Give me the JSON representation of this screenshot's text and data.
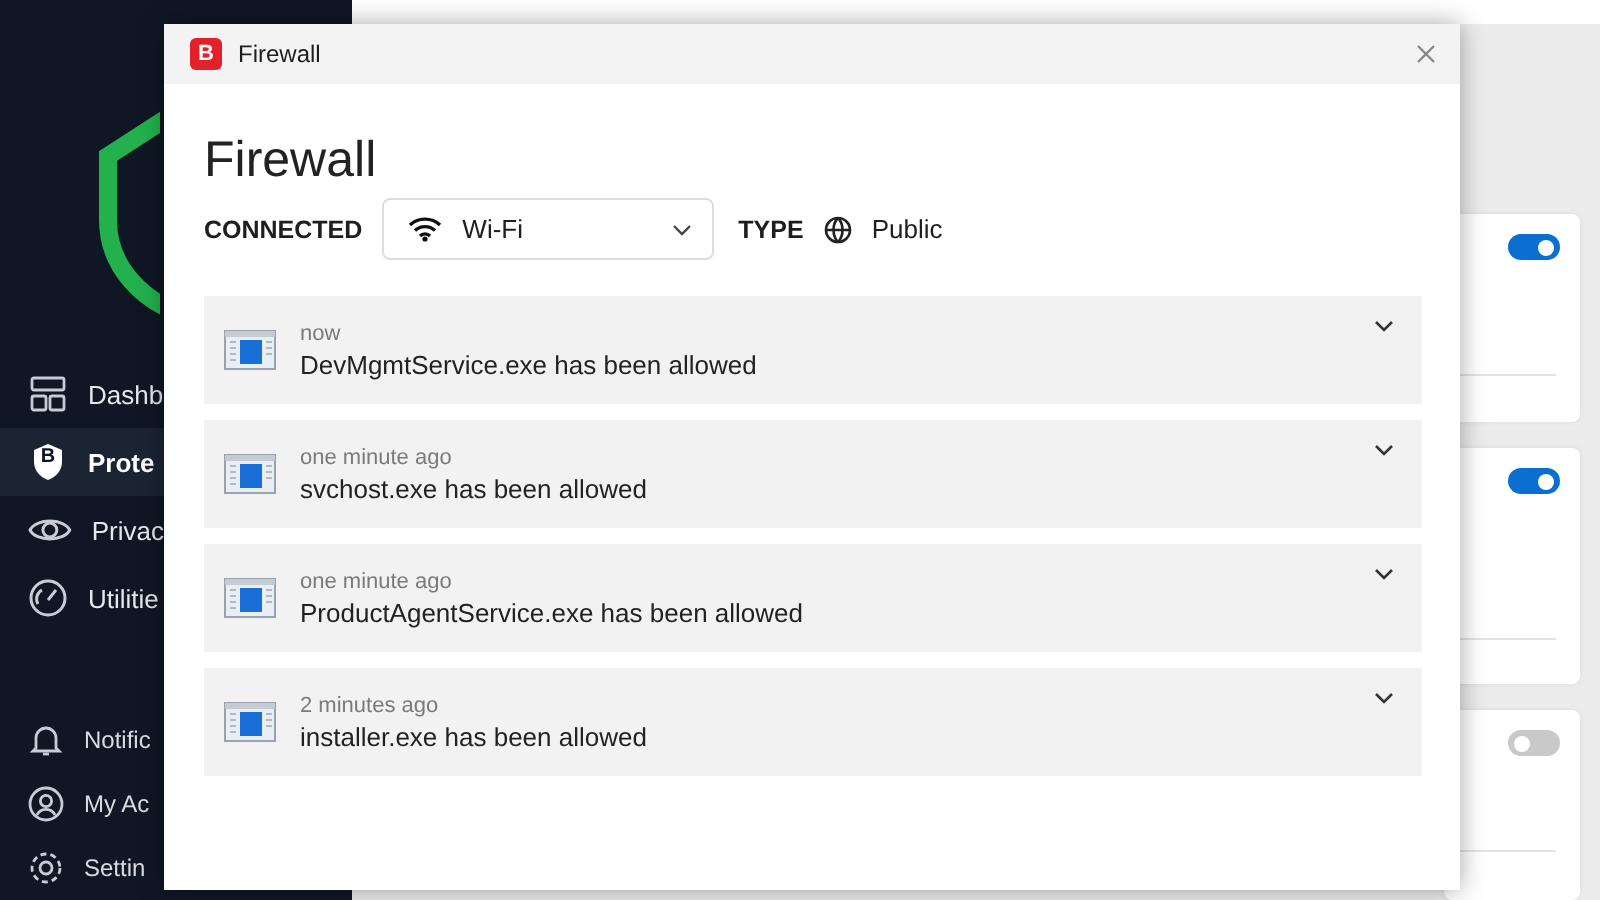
{
  "sidebar": {
    "items": [
      {
        "label": "Dashb",
        "selected": false
      },
      {
        "label": "Prote",
        "selected": true,
        "badge": "B"
      },
      {
        "label": "Privac",
        "selected": false
      },
      {
        "label": "Utilitie",
        "selected": false
      }
    ],
    "bottom_items": [
      {
        "label": "Notific"
      },
      {
        "label": "My Ac"
      },
      {
        "label": "Settin"
      }
    ]
  },
  "cards": [
    {
      "on": true
    },
    {
      "on": true
    },
    {
      "on": false
    }
  ],
  "dialog": {
    "logo": "B",
    "title": "Firewall",
    "heading": "Firewall",
    "connected_label": "CONNECTED",
    "network": "Wi-Fi",
    "type_label": "TYPE",
    "type_value": "Public",
    "events": [
      {
        "time": "now",
        "message": "DevMgmtService.exe has been allowed"
      },
      {
        "time": "one minute ago",
        "message": "svchost.exe has been allowed"
      },
      {
        "time": "one minute ago",
        "message": "ProductAgentService.exe has been allowed"
      },
      {
        "time": "2 minutes ago",
        "message": "installer.exe has been allowed"
      }
    ]
  }
}
